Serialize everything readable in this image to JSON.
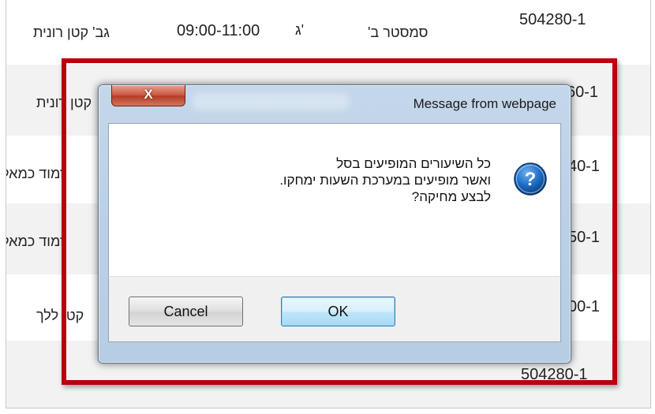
{
  "table": {
    "rows": [
      {
        "id": "504280-1",
        "semester": "סמסטר ב'",
        "day": "ג'",
        "time": "09:00-11:00",
        "lecturer": "גב' קטן רונית"
      },
      {
        "id": "60-1",
        "lecturer": "קטן רונית"
      },
      {
        "id": "40-1",
        "lecturer": "זמוד כמאל"
      },
      {
        "id": "50-1",
        "lecturer": "זמוד כמאל"
      },
      {
        "id": "00-1",
        "lecturer": "קטן ללך"
      },
      {
        "id": "504280-1"
      }
    ]
  },
  "dialog": {
    "title": "Message from webpage",
    "close_label": "X",
    "message_lines": [
      "כל השיעורים המופיעים בסל",
      "ואשר מופיעים במערכת השעות ימחקו.",
      "לבצע מחיקה?"
    ],
    "icon": "question-icon",
    "buttons": {
      "cancel": "Cancel",
      "ok": "OK"
    }
  },
  "colors": {
    "highlight": "#b8000e",
    "question_icon": "#1a6bc2"
  }
}
